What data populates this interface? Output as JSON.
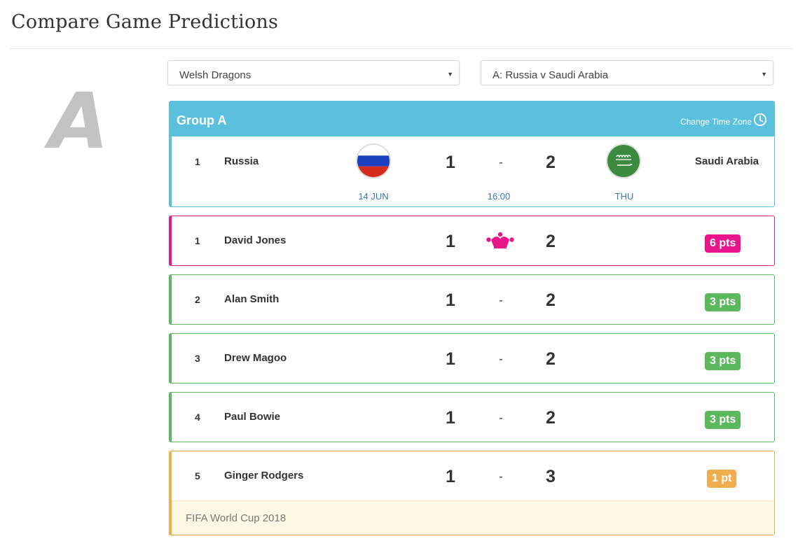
{
  "page": {
    "title": "Compare Game Predictions",
    "group_letter": "A"
  },
  "selectors": {
    "league": {
      "value": "Welsh Dragons"
    },
    "match": {
      "value": "A: Russia v Saudi Arabia"
    }
  },
  "match": {
    "group": "Group A",
    "change_tz_label": "Change Time Zone",
    "rank": "1",
    "home_team": "Russia",
    "away_team": "Saudi Arabia",
    "home_score": "1",
    "away_score": "2",
    "separator": "-",
    "date": "14 JUN",
    "time": "16:00",
    "day": "THU",
    "home_flag": "russia-flag",
    "away_flag": "saudi-arabia-flag"
  },
  "predictions": [
    {
      "rank": "1",
      "name": "David Jones",
      "home": "1",
      "away": "2",
      "separator": "",
      "icon": "jester-icon",
      "points": "6 pts",
      "color": "#e8168a",
      "badge_color": "#e8168a"
    },
    {
      "rank": "2",
      "name": "Alan Smith",
      "home": "1",
      "away": "2",
      "separator": "-",
      "points": "3 pts",
      "color": "#5cb85c",
      "badge_color": "#5cb85c"
    },
    {
      "rank": "3",
      "name": "Drew Magoo",
      "home": "1",
      "away": "2",
      "separator": "-",
      "points": "3 pts",
      "color": "#5cb85c",
      "badge_color": "#5cb85c"
    },
    {
      "rank": "4",
      "name": "Paul Bowie",
      "home": "1",
      "away": "2",
      "separator": "-",
      "points": "3 pts",
      "color": "#5cb85c",
      "badge_color": "#5cb85c"
    },
    {
      "rank": "5",
      "name": "Ginger Rodgers",
      "home": "1",
      "away": "3",
      "separator": "-",
      "points": "1 pt",
      "color": "#f0ad4e",
      "badge_color": "#f0ad4e"
    }
  ],
  "footer_note": "FIFA World Cup 2018",
  "colors": {
    "info": "#5bc0de",
    "link": "#337ab7",
    "pink": "#e8168a",
    "green": "#5cb85c",
    "orange": "#f0ad4e"
  }
}
